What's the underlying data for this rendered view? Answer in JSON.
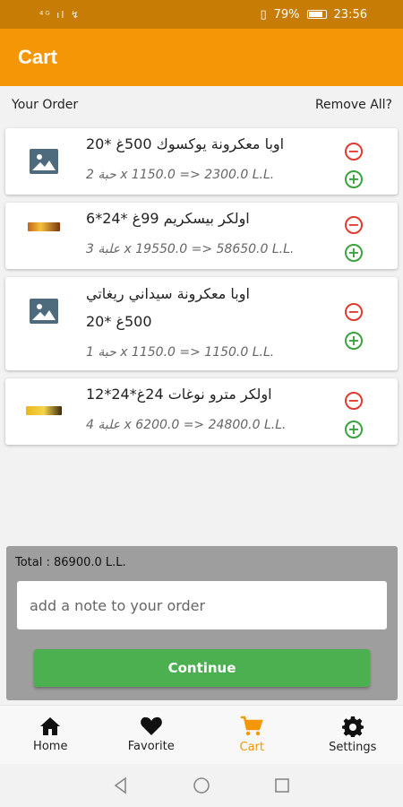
{
  "status_bar": {
    "signal": "⁴ᴳ ıl ↯",
    "vibrate": "▯",
    "battery_pct": "79%",
    "time": "23:56"
  },
  "app_bar": {
    "title": "Cart"
  },
  "order_header": {
    "label": "Your Order",
    "remove_all": "Remove All?"
  },
  "items": [
    {
      "name": "اوبا معكرونة يوكسوك  500غ *20",
      "calc": "2 حبة x 1150.0 => 2300.0 L.L.",
      "image": "image-placeholder-icon",
      "minus": "−",
      "plus": "+"
    },
    {
      "name": "اولكر بيسكريم 99غ *24*6",
      "calc": "3 علبة x 19550.0 => 58650.0 L.L.",
      "image": "product-photo",
      "minus": "−",
      "plus": "+"
    },
    {
      "name_line1": "اوبا معكرونة سيداني ريغاتي",
      "name_line2": "500غ *20",
      "calc": "1 حبة x 1150.0 => 1150.0 L.L.",
      "image": "image-placeholder-icon",
      "minus": "−",
      "plus": "+"
    },
    {
      "name": "اولكر مترو نوغات 24غ*24*12",
      "calc": "4 علبة x 6200.0 => 24800.0 L.L.",
      "image": "product-photo",
      "minus": "−",
      "plus": "+"
    }
  ],
  "summary": {
    "total": "Total : 86900.0 L.L.",
    "note_placeholder": "add a note to your order",
    "continue": "Continue"
  },
  "bottom_nav": [
    {
      "label": "Home",
      "icon": "home-icon"
    },
    {
      "label": "Favorite",
      "icon": "heart-icon"
    },
    {
      "label": "Cart",
      "icon": "cart-icon",
      "active": true
    },
    {
      "label": "Settings",
      "icon": "gear-icon"
    }
  ],
  "colors": {
    "accent": "#f39706",
    "status_bar": "#c77d05",
    "continue": "#4caf50",
    "minus": "#e03b30",
    "plus": "#3ba33f"
  }
}
